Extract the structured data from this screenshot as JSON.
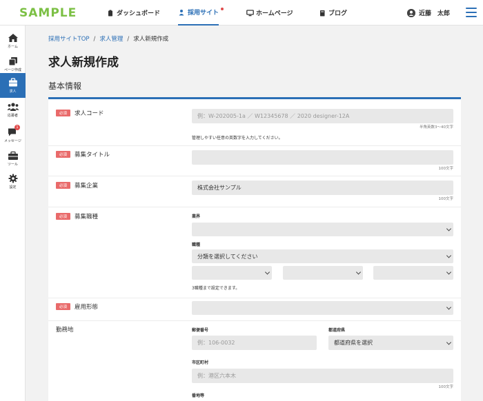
{
  "header": {
    "logo": "SAMPLE",
    "nav": [
      {
        "label": "ダッシュボード",
        "icon": "clipboard-icon"
      },
      {
        "label": "採用サイト",
        "icon": "person-icon"
      },
      {
        "label": "ホームページ",
        "icon": "monitor-icon"
      },
      {
        "label": "ブログ",
        "icon": "book-icon"
      }
    ],
    "user_name": "近藤　太郎"
  },
  "sidebar": {
    "items": [
      {
        "label": "ホーム",
        "icon": "home-icon"
      },
      {
        "label": "ページ作成",
        "icon": "pages-icon"
      },
      {
        "label": "求人",
        "icon": "briefcase-icon"
      },
      {
        "label": "応募者",
        "icon": "users-icon"
      },
      {
        "label": "メッセージ",
        "icon": "chat-icon",
        "badge": "1"
      },
      {
        "label": "ツール",
        "icon": "toolbox-icon"
      },
      {
        "label": "設定",
        "icon": "gear-icon"
      }
    ]
  },
  "breadcrumb": {
    "items": [
      "採用サイトTOP",
      "求人管理",
      "求人新規作成"
    ],
    "separator": "/"
  },
  "page": {
    "title": "求人新規作成",
    "section_title": "基本情報"
  },
  "form": {
    "required_badge": "必須",
    "job_code": {
      "label": "求人コード",
      "placeholder": "例：W-202005-1a ／ W12345678 ／ 2020 designer-12A",
      "hint": "半角英数3〜40文字",
      "help": "管理しやすい任意の英数字を入力してください。"
    },
    "job_title": {
      "label": "募集タイトル",
      "value": "",
      "hint": "100文字"
    },
    "company": {
      "label": "募集企業",
      "value": "株式会社サンプル",
      "hint": "100文字"
    },
    "job_type": {
      "label": "募集職種",
      "industry_label": "業界",
      "industry_value": "",
      "occupation_label": "職種",
      "occupation_value": "分類を選択してください",
      "help": "3職種まで設定できます。"
    },
    "employment": {
      "label": "雇用形態",
      "value": ""
    },
    "location": {
      "label": "勤務地",
      "postal_label": "郵便番号",
      "postal_placeholder": "例：106-0032",
      "pref_label": "都道府県",
      "pref_value": "都道府県を選択",
      "city_label": "市区町村",
      "city_placeholder": "例：港区六本木",
      "city_hint": "100文字",
      "address_label": "番地等"
    }
  }
}
